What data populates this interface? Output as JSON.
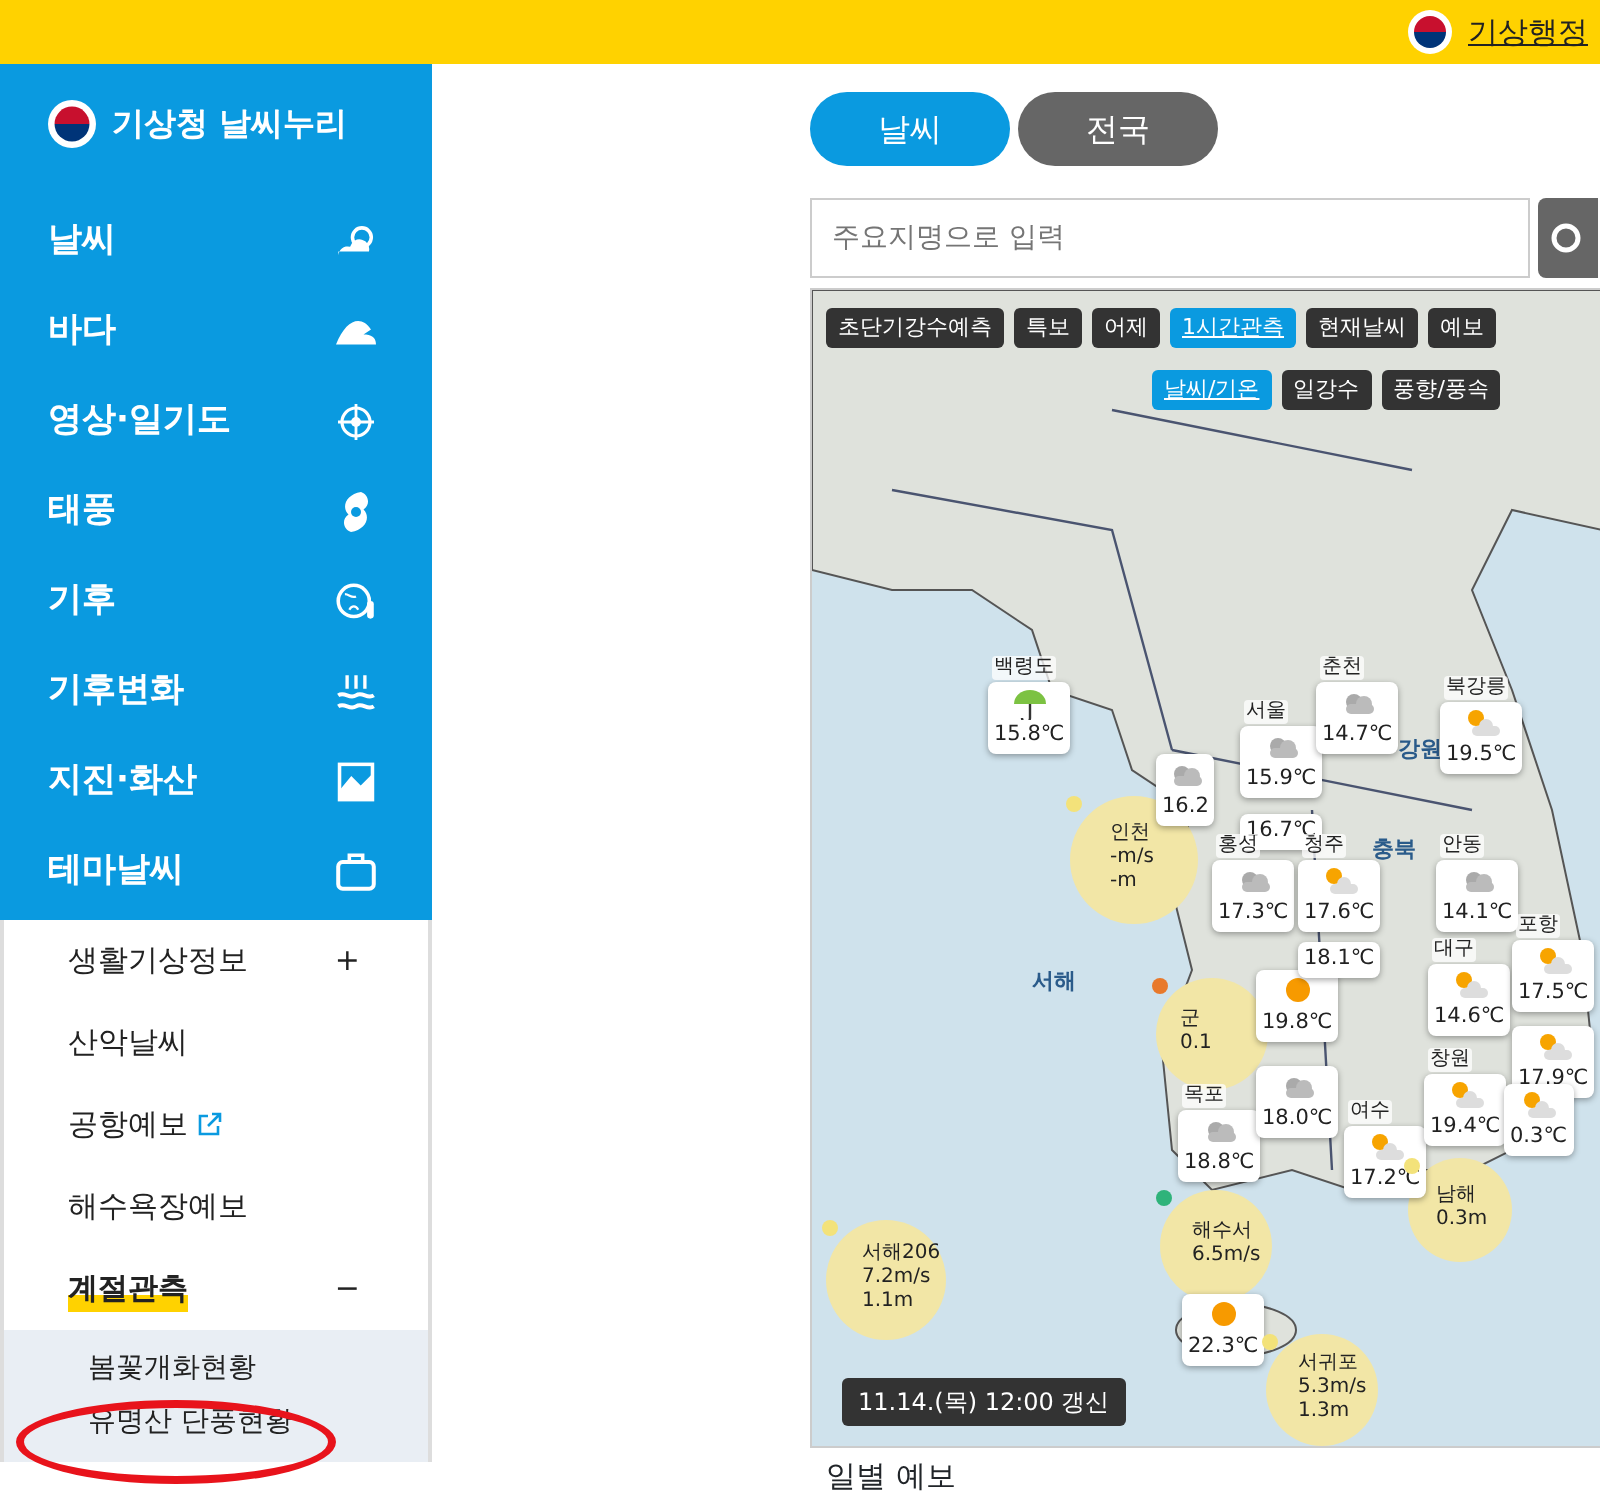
{
  "top_bar": {
    "link": "기상행정"
  },
  "sidebar": {
    "logo": "기상청 날씨누리",
    "menu": [
      {
        "label": "날씨"
      },
      {
        "label": "바다"
      },
      {
        "label": "영상·일기도"
      },
      {
        "label": "태풍"
      },
      {
        "label": "기후"
      },
      {
        "label": "기후변화"
      },
      {
        "label": "지진·화산"
      },
      {
        "label": "테마날씨"
      }
    ],
    "submenu": [
      {
        "label": "생활기상정보",
        "sign": "+",
        "selected": false
      },
      {
        "label": "산악날씨",
        "selected": false
      },
      {
        "label": "공항예보",
        "selected": false,
        "external": true
      },
      {
        "label": "해수욕장예보",
        "selected": false
      },
      {
        "label": "계절관측",
        "sign": "−",
        "selected": true,
        "children": [
          {
            "label": "봄꽃개화현황"
          },
          {
            "label": "유명산 단풍현황"
          }
        ]
      }
    ]
  },
  "tabs": [
    {
      "label": "날씨",
      "selected": true
    },
    {
      "label": "전국",
      "selected": false
    }
  ],
  "search": {
    "placeholder": "주요지명으로 입력"
  },
  "map": {
    "buttons": [
      {
        "label": "초단기강수예측",
        "selected": false
      },
      {
        "label": "특보",
        "selected": false
      },
      {
        "label": "어제",
        "selected": false
      },
      {
        "label": "1시간관측",
        "selected": true
      },
      {
        "label": "현재날씨",
        "selected": false
      },
      {
        "label": "예보",
        "selected": false
      }
    ],
    "sub_buttons": [
      {
        "label": "날씨/기온",
        "selected": true
      },
      {
        "label": "일강수",
        "selected": false
      },
      {
        "label": "풍향/풍속",
        "selected": false
      }
    ],
    "regions": [
      "서해",
      "강원",
      "충북"
    ],
    "markers": [
      {
        "kind": "rain",
        "name": "백령도",
        "temp": "15.8℃"
      },
      {
        "kind": "cloudy",
        "temp": "16.2"
      },
      {
        "kind": "cloudy",
        "name": "서울",
        "temp": "15.9℃"
      },
      {
        "kind": "cloudy",
        "name": "춘천",
        "temp": "14.7℃"
      },
      {
        "kind": "partly",
        "name": "북강릉",
        "temp": "19.5℃"
      },
      {
        "kind": "buoy",
        "name": "인천",
        "wind": "-m/s",
        "wave": "-m",
        "color": "#f3e27a"
      },
      {
        "kind": "plain",
        "temp": "16.7℃"
      },
      {
        "kind": "cloudy",
        "name": "홍성",
        "temp": "17.3℃"
      },
      {
        "kind": "partly",
        "name": "청주",
        "temp": "17.6℃"
      },
      {
        "kind": "cloudy",
        "name": "안동",
        "temp": "14.1℃"
      },
      {
        "kind": "buoy",
        "name": "군",
        "wave": "0.1",
        "color": "#e8792b"
      },
      {
        "kind": "sunny",
        "temp": "19.8℃"
      },
      {
        "kind": "plain",
        "temp": "18.1℃"
      },
      {
        "kind": "partly",
        "name": "대구",
        "temp": "14.6℃"
      },
      {
        "kind": "partly",
        "name": "포항",
        "temp": "17.5℃"
      },
      {
        "kind": "partly",
        "temp": "17.9℃"
      },
      {
        "kind": "cloudy",
        "name": "목포",
        "temp": "18.8℃"
      },
      {
        "kind": "cloudy",
        "temp": "18.0℃"
      },
      {
        "kind": "partly",
        "name": "여수",
        "temp": "17.2℃"
      },
      {
        "kind": "partly",
        "name": "창원",
        "temp": "19.4℃"
      },
      {
        "kind": "partly",
        "temp": "0.3℃"
      },
      {
        "kind": "buoy",
        "name": "남해",
        "wave": "0.3m",
        "color": "#f3e27a"
      },
      {
        "kind": "buoy",
        "name": "서해206",
        "wind": "7.2m/s",
        "wave": "1.1m",
        "color": "#f3e27a"
      },
      {
        "kind": "buoy",
        "name": "해수서",
        "wind": "6.5m/s",
        "color": "#2fb37a"
      },
      {
        "kind": "sunny",
        "temp": "22.3℃"
      },
      {
        "kind": "buoy",
        "name": "서귀포",
        "wind": "5.3m/s",
        "wave": "1.3m",
        "color": "#f3e27a"
      }
    ],
    "updated": "11.14.(목) 12:00 갱신"
  },
  "section_heading": "일별 예보"
}
